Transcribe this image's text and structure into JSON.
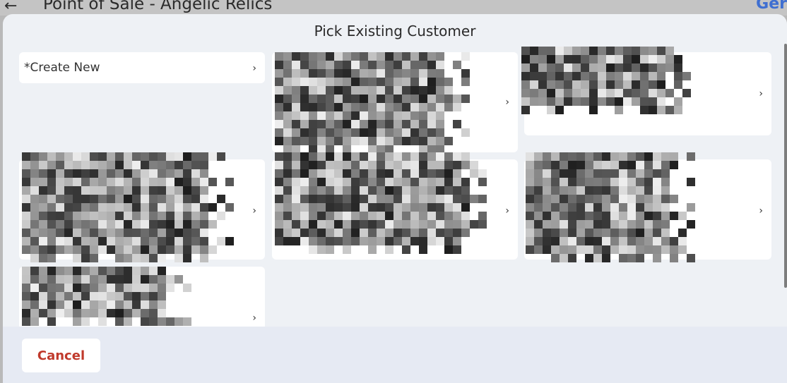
{
  "app_bar": {
    "back_icon": "←",
    "title": "Point of Sale - Angelic Relics",
    "link_partial": "Ger"
  },
  "dialog": {
    "title": "Pick Existing Customer",
    "chevron": "›",
    "create_new_label": "*Create New",
    "cancel_label": "Cancel"
  },
  "colors": {
    "accent_link": "#3f6fd1",
    "cancel_text": "#c0392b",
    "dialog_bg": "#eef1f5"
  }
}
